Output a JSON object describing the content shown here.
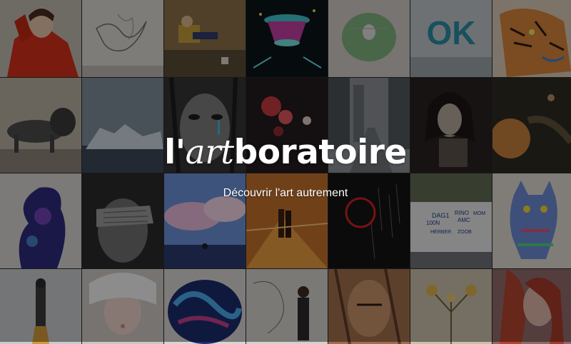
{
  "hero": {
    "logo_prefix": "l'",
    "logo_accent": "art",
    "logo_suffix": "boratoire",
    "tagline": "Découvrir l'art autrement"
  },
  "tiles": [
    {
      "name": "tile-portrait-red-coat",
      "bg": "#c9c2b7"
    },
    {
      "name": "tile-ink-sketch",
      "bg": "#d7d4cf"
    },
    {
      "name": "tile-figure-on-wall",
      "bg": "#8b7452"
    },
    {
      "name": "tile-neon-sculpture",
      "bg": "#0e1a1f"
    },
    {
      "name": "tile-painted-stone",
      "bg": "#c7c4bf"
    },
    {
      "name": "tile-ok-sign",
      "bg": "#bfc7cc",
      "text": "OK"
    },
    {
      "name": "tile-tiger-painting",
      "bg": "#c9b39b"
    },
    {
      "name": "tile-lion-sculpture",
      "bg": "#b8b0a3"
    },
    {
      "name": "tile-icebergs",
      "bg": "#6d7f8f"
    },
    {
      "name": "tile-woman-face-drawing",
      "bg": "#3b3b3b"
    },
    {
      "name": "tile-red-flowers",
      "bg": "#2b1f24"
    },
    {
      "name": "tile-city-street",
      "bg": "#5f6469"
    },
    {
      "name": "tile-pensive-portrait",
      "bg": "#2a2624"
    },
    {
      "name": "tile-planets",
      "bg": "#2f2a1f"
    },
    {
      "name": "tile-galaxy-silhouette",
      "bg": "#2a2f6b"
    },
    {
      "name": "tile-hand-over-eyes",
      "bg": "#4a4a4a"
    },
    {
      "name": "tile-sky-meditation",
      "bg": "#6d8fd1"
    },
    {
      "name": "tile-couple-sunset",
      "bg": "#b86a2a"
    },
    {
      "name": "tile-red-circle-hands",
      "bg": "#151515"
    },
    {
      "name": "tile-street-sign-wall",
      "bg": "#9ca7b1"
    },
    {
      "name": "tile-colorful-cat",
      "bg": "#d9d4ce"
    },
    {
      "name": "tile-pencil-sculpture",
      "bg": "#c6c8c9"
    },
    {
      "name": "tile-white-hair-girl",
      "bg": "#c9c4c0"
    },
    {
      "name": "tile-blue-swirl-bowl",
      "bg": "#1a2a63"
    },
    {
      "name": "tile-wall-drawing-artist",
      "bg": "#d3d0cc"
    },
    {
      "name": "tile-abstract-face",
      "bg": "#9a6d4e"
    },
    {
      "name": "tile-golden-flowers",
      "bg": "#bdb29a"
    },
    {
      "name": "tile-red-hair-painting",
      "bg": "#8e5e61"
    }
  ],
  "sign_text": {
    "line1": "DAG1",
    "line2": "100N",
    "line3": "RINO",
    "line4": "AMC",
    "line5": "HERBER",
    "line6": "ZOOB",
    "line7": "MOM"
  }
}
